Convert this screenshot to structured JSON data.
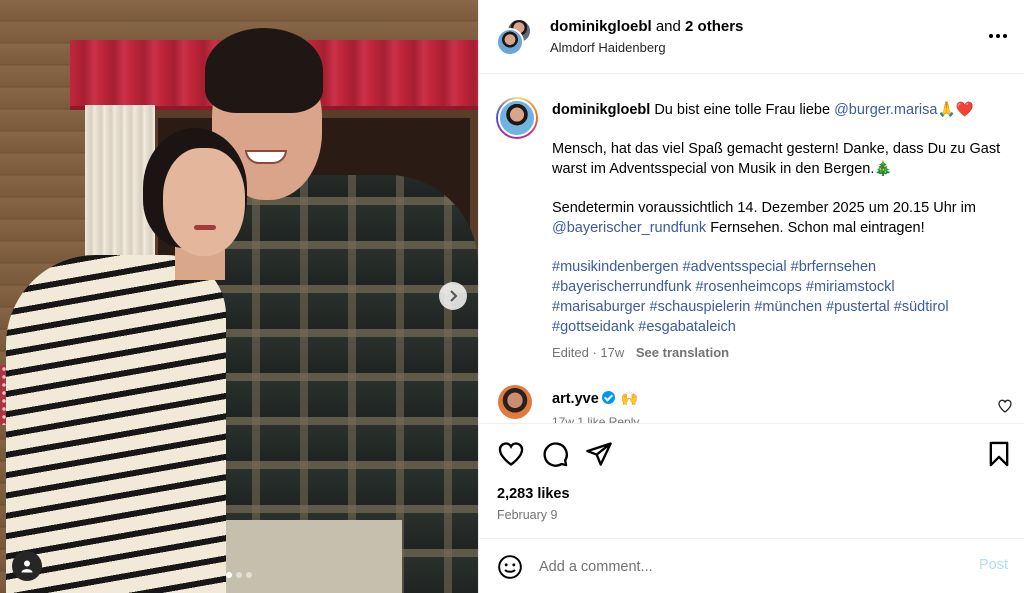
{
  "header": {
    "username": "dominikgloebl",
    "and_text": " and ",
    "others": "2 others",
    "location": "Almdorf Haidenberg"
  },
  "caption": {
    "username": "dominikgloebl",
    "line1_text": "Du bist eine tolle Frau liebe ",
    "mention1": "@burger.marisa",
    "line1_emoji": "🙏❤️",
    "para2": "Mensch, hat das viel Spaß gemacht gestern! Danke, dass Du zu Gast warst im Adventsspecial von Musik in den Bergen.🎄",
    "para3_text": "Sendetermin voraussichtlich 14. Dezember 2025 um 20.15 Uhr im ",
    "mention2": "@bayerischer_rundfunk",
    "para3_tail": " Fernsehen. Schon mal eintragen!",
    "hashtags": [
      "#musikindenbergen",
      "#adventsspecial",
      "#brfernsehen",
      "#bayerischerrundfunk",
      "#rosenheimcops",
      "#miriamstockl",
      "#marisaburger",
      "#schauspielerin",
      "#münchen",
      "#pustertal",
      "#südtirol",
      "#gottseidank",
      "#esgabataleich"
    ],
    "edited": "Edited · 17w",
    "see_translation": "See translation"
  },
  "comment": {
    "username": "art.yve",
    "emoji": "🙌",
    "sub": "17w   1 like   Reply"
  },
  "actions": {
    "likes": "2,283 likes",
    "date": "February 9"
  },
  "add_comment": {
    "emoji_icon": "smiley-icon",
    "placeholder": "Add a comment...",
    "post_label": "Post"
  },
  "media": {
    "slide_count": 3,
    "active_slide": 0
  },
  "colors": {
    "link": "#3a5ba0",
    "muted": "#737373",
    "post_disabled": "#b3dbff",
    "verified": "#0095f6"
  }
}
